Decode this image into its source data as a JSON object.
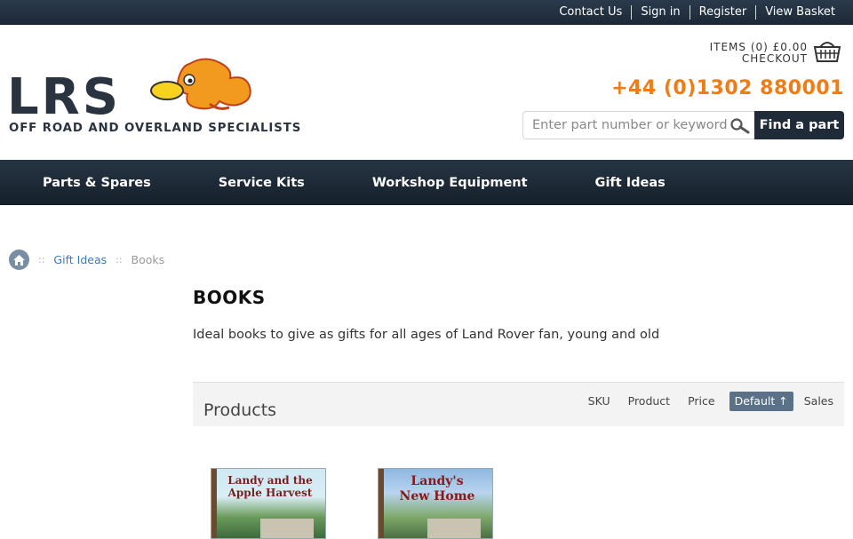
{
  "topbar": {
    "links": [
      "Contact Us",
      "Sign in",
      "Register",
      "View Basket"
    ]
  },
  "header": {
    "brand": "LRS",
    "tagline": "OFF ROAD AND OVERLAND SPECIALISTS",
    "basket": {
      "items_text": "ITEMS (0) £0.00",
      "checkout_text": "CHECKOUT"
    },
    "phone": "+44 (0)1302 880001",
    "search": {
      "placeholder": "Enter part number or keywords",
      "button_label": "Find a part"
    }
  },
  "nav": {
    "items": [
      "Parts & Spares",
      "Service Kits",
      "Workshop Equipment",
      "Gift Ideas"
    ]
  },
  "breadcrumb": {
    "separator": "::",
    "link": "Gift Ideas",
    "current": "Books"
  },
  "page": {
    "title": "BOOKS",
    "description": "Ideal books to give as gifts for all ages of Land Rover fan, young and old"
  },
  "products": {
    "label": "Products",
    "sort_options": [
      "SKU",
      "Product",
      "Price",
      "Default ↑",
      "Sales"
    ],
    "active_sort": "Default ↑",
    "items": [
      {
        "title_line1": "Landy and the",
        "title_line2": "Apple Harvest"
      },
      {
        "title_line1": "Landy's",
        "title_line2": "New Home"
      }
    ]
  },
  "colors": {
    "topbar": "#1c2836",
    "nav": "#1f2b38",
    "accent_orange": "#f07c15",
    "link_blue": "#3d7ab5",
    "sort_active": "#5b7187"
  }
}
